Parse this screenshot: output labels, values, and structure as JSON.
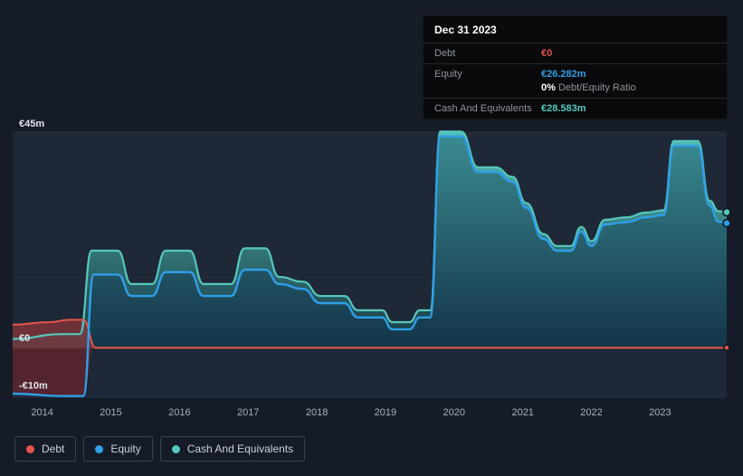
{
  "tooltip": {
    "date": "Dec 31 2023",
    "rows": [
      {
        "label": "Debt",
        "value": "€0"
      },
      {
        "label": "Equity",
        "value": "€26.282m",
        "sub_value": "0%",
        "sub_label": " Debt/Equity Ratio"
      },
      {
        "label": "Cash And Equivalents",
        "value": "€28.583m"
      }
    ]
  },
  "legend": {
    "items": [
      {
        "label": "Debt"
      },
      {
        "label": "Equity"
      },
      {
        "label": "Cash And Equivalents"
      }
    ]
  },
  "chart_data": {
    "type": "area",
    "unit": "€m",
    "x_domain": [
      2013.57,
      2023.97
    ],
    "x_ticks": [
      {
        "label": "2014",
        "value": 2014
      },
      {
        "label": "2015",
        "value": 2015
      },
      {
        "label": "2016",
        "value": 2016
      },
      {
        "label": "2017",
        "value": 2017
      },
      {
        "label": "2018",
        "value": 2018
      },
      {
        "label": "2019",
        "value": 2019
      },
      {
        "label": "2020",
        "value": 2020
      },
      {
        "label": "2021",
        "value": 2021
      },
      {
        "label": "2022",
        "value": 2022
      },
      {
        "label": "2023",
        "value": 2023
      }
    ],
    "y_ticks": [
      {
        "label": "€45m",
        "value": 45
      },
      {
        "label": "€0",
        "value": 0
      },
      {
        "label": "-€10m",
        "value": -10
      }
    ],
    "y_grid": [
      45,
      30,
      15,
      0,
      -10
    ],
    "legend_position": "bottom-left",
    "series": [
      {
        "name": "Debt",
        "color": "#e4554c",
        "fill": "rgba(190,58,58,0.5)",
        "final_value_label": "€0",
        "points": [
          [
            2013.57,
            5
          ],
          [
            2014.1,
            5.5
          ],
          [
            2014.4,
            6
          ],
          [
            2014.6,
            6
          ],
          [
            2014.78,
            0.15
          ],
          [
            2015.0,
            0.15
          ],
          [
            2023.97,
            0.15
          ]
        ]
      },
      {
        "name": "Equity",
        "color": "#2f9fe8",
        "fill": "rgba(15,45,80,0.35)",
        "negative_fill": "#57242e",
        "final_value_label": "€26.282m",
        "points": [
          [
            2013.57,
            -9.5
          ],
          [
            2014.3,
            -10
          ],
          [
            2014.6,
            -10
          ],
          [
            2014.75,
            15.5
          ],
          [
            2015.1,
            15.5
          ],
          [
            2015.3,
            11
          ],
          [
            2015.6,
            11
          ],
          [
            2015.8,
            16
          ],
          [
            2016.15,
            16
          ],
          [
            2016.35,
            11
          ],
          [
            2016.75,
            11
          ],
          [
            2016.95,
            16.5
          ],
          [
            2017.25,
            16.5
          ],
          [
            2017.45,
            13.5
          ],
          [
            2017.8,
            12.5
          ],
          [
            2018.05,
            9.5
          ],
          [
            2018.4,
            9.5
          ],
          [
            2018.6,
            6.5
          ],
          [
            2018.95,
            6.5
          ],
          [
            2019.1,
            4
          ],
          [
            2019.35,
            4
          ],
          [
            2019.5,
            6.5
          ],
          [
            2019.65,
            6.5
          ],
          [
            2019.8,
            44.5
          ],
          [
            2020.1,
            44.5
          ],
          [
            2020.35,
            37
          ],
          [
            2020.6,
            37
          ],
          [
            2020.85,
            35
          ],
          [
            2021.05,
            29.5
          ],
          [
            2021.3,
            23
          ],
          [
            2021.5,
            20.5
          ],
          [
            2021.7,
            20.5
          ],
          [
            2021.85,
            24.5
          ],
          [
            2022.0,
            21.5
          ],
          [
            2022.2,
            26
          ],
          [
            2022.5,
            26.5
          ],
          [
            2022.8,
            27.5
          ],
          [
            2023.05,
            28
          ],
          [
            2023.2,
            42.5
          ],
          [
            2023.55,
            42.5
          ],
          [
            2023.72,
            30
          ],
          [
            2023.85,
            26.6
          ],
          [
            2023.97,
            26.282
          ]
        ]
      },
      {
        "name": "Cash And Equivalents",
        "color": "#56c7bc",
        "fill_top": "#56c9bd",
        "fill_bottom": "#173a47",
        "final_value_label": "€28.583m",
        "points": [
          [
            2013.57,
            2
          ],
          [
            2014.3,
            3
          ],
          [
            2014.55,
            3
          ],
          [
            2014.72,
            20.5
          ],
          [
            2015.1,
            20.5
          ],
          [
            2015.3,
            13.5
          ],
          [
            2015.6,
            13.5
          ],
          [
            2015.8,
            20.5
          ],
          [
            2016.15,
            20.5
          ],
          [
            2016.35,
            13.5
          ],
          [
            2016.75,
            13.5
          ],
          [
            2016.95,
            21
          ],
          [
            2017.25,
            21
          ],
          [
            2017.45,
            15
          ],
          [
            2017.8,
            14
          ],
          [
            2018.05,
            11
          ],
          [
            2018.4,
            11
          ],
          [
            2018.6,
            8
          ],
          [
            2018.95,
            8
          ],
          [
            2019.1,
            5.5
          ],
          [
            2019.35,
            5.5
          ],
          [
            2019.5,
            8
          ],
          [
            2019.65,
            8
          ],
          [
            2019.8,
            45.5
          ],
          [
            2020.1,
            45.5
          ],
          [
            2020.35,
            38
          ],
          [
            2020.6,
            38
          ],
          [
            2020.85,
            36
          ],
          [
            2021.05,
            30.5
          ],
          [
            2021.3,
            24
          ],
          [
            2021.5,
            21.5
          ],
          [
            2021.7,
            21.5
          ],
          [
            2021.85,
            25.5
          ],
          [
            2022.0,
            22.5
          ],
          [
            2022.2,
            27
          ],
          [
            2022.5,
            27.5
          ],
          [
            2022.8,
            28.5
          ],
          [
            2023.05,
            29
          ],
          [
            2023.2,
            43.5
          ],
          [
            2023.55,
            43.5
          ],
          [
            2023.72,
            31
          ],
          [
            2023.85,
            28.8
          ],
          [
            2023.97,
            28.583
          ]
        ]
      }
    ]
  }
}
